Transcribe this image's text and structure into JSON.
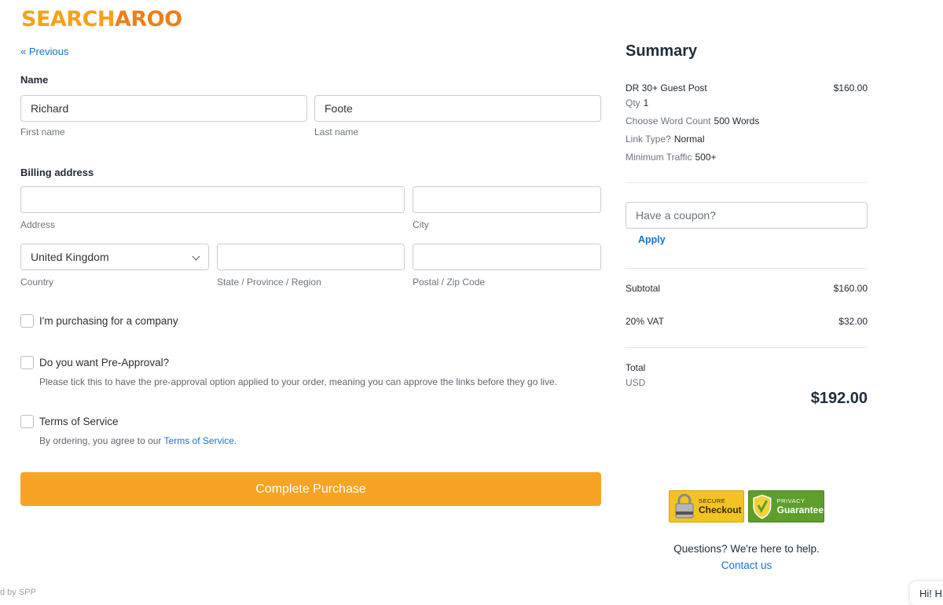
{
  "brand": {
    "logo_part1": "SEARCH",
    "logo_part2": "AROO"
  },
  "nav": {
    "previous_label": "« Previous"
  },
  "name_section": {
    "title": "Name",
    "first_name_value": "Richard",
    "first_name_hint": "First name",
    "last_name_value": "Foote",
    "last_name_hint": "Last name"
  },
  "billing": {
    "title": "Billing address",
    "address_hint": "Address",
    "city_hint": "City",
    "country_value": "United Kingdom",
    "country_hint": "Country",
    "state_hint": "State / Province / Region",
    "postal_hint": "Postal / Zip Code"
  },
  "options": {
    "company_label": "I'm purchasing for a company",
    "preapproval_label": "Do you want Pre-Approval?",
    "preapproval_desc": "Please tick this to have the pre-approval option applied to your order, meaning you can approve the links before they go live.",
    "tos_label": "Terms of Service",
    "tos_desc_prefix": "By ordering, you agree to our ",
    "tos_link": "Terms of Service",
    "tos_desc_suffix": "."
  },
  "submit_label": "Complete Purchase",
  "summary": {
    "title": "Summary",
    "product_name": "DR 30+ Guest Post",
    "product_price": "$160.00",
    "qty_label": "Qty",
    "qty_value": "1",
    "word_count_label": "Choose Word Count",
    "word_count_value": "500 Words",
    "link_type_label": "Link Type?",
    "link_type_value": "Normal",
    "traffic_label": "Minimum Traffic",
    "traffic_value": "500+",
    "coupon_placeholder": "Have a coupon?",
    "apply_label": "Apply",
    "subtotal_label": "Subtotal",
    "subtotal_value": "$160.00",
    "vat_label": "20% VAT",
    "vat_value": "$32.00",
    "total_label": "Total",
    "currency": "USD",
    "total_value": "$192.00"
  },
  "badges": {
    "secure_small": "SECURE",
    "secure_big": "Checkout",
    "privacy_small": "PRIVACY",
    "privacy_big": "Guarantee"
  },
  "help": {
    "question": "Questions? We're here to help.",
    "contact": "Contact us"
  },
  "footer": {
    "powered": "d by SPP",
    "chat_partial": "Hi! H"
  },
  "colors": {
    "accent": "#f7a424",
    "link": "#1573d6",
    "secure_badge": "#f3c323",
    "privacy_badge": "#5d9e2c"
  }
}
